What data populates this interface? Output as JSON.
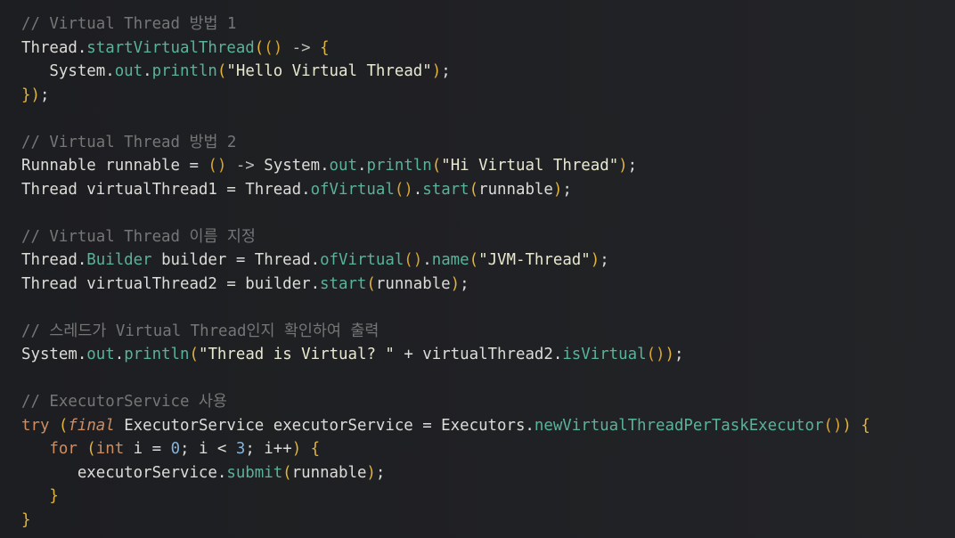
{
  "code": {
    "comment1": "// Virtual Thread 방법 1",
    "comment2": "// Virtual Thread 방법 2",
    "comment3": "// Virtual Thread 이름 지정",
    "comment4": "// 스레드가 Virtual Thread인지 확인하여 출력",
    "comment5": "// ExecutorService 사용",
    "str_hello": "\"Hello Virtual Thread\"",
    "str_hi": "\"Hi Virtual Thread\"",
    "str_jvm": "\"JVM-Thread\"",
    "str_isvirtual": "\"Thread is Virtual? \"",
    "num_zero": "0",
    "num_three": "3"
  }
}
